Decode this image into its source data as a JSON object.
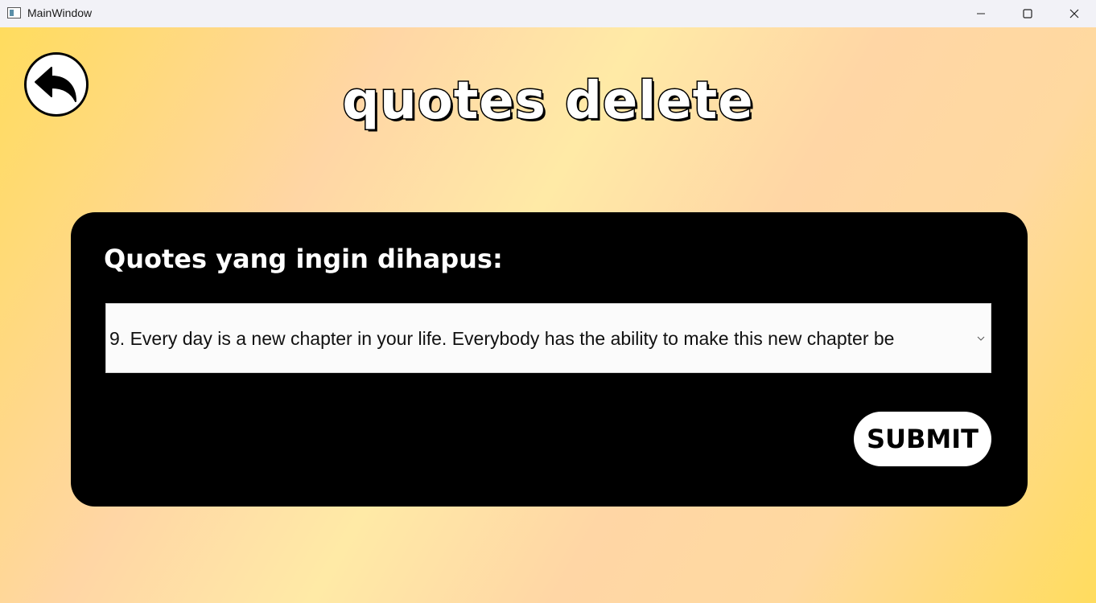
{
  "window": {
    "title": "MainWindow"
  },
  "header": {
    "title": "quotes delete",
    "back_icon": "back-arrow-icon"
  },
  "form": {
    "label": "Quotes yang ingin dihapus:",
    "select": {
      "selected_value": "9.  Every day is a new chapter in your life. Everybody has the ability to make this new chapter be"
    },
    "submit_label": "SUBMIT"
  },
  "colors": {
    "panel": "#000000",
    "background_primary": "#ffdc5e",
    "background_secondary": "#ffd6a5",
    "button_fill": "#ffffff"
  }
}
